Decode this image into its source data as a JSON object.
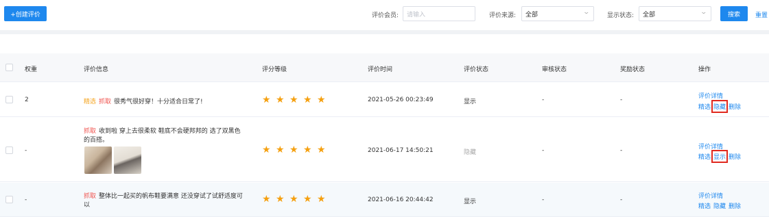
{
  "toolbar": {
    "create_label": "+创建评价",
    "member_label": "评价会员:",
    "member_placeholder": "请输入",
    "source_label": "评价来源:",
    "source_value": "全部",
    "status_label": "显示状态:",
    "status_value": "全部",
    "search_label": "搜索",
    "reset_label": "重置"
  },
  "table": {
    "headers": {
      "weight": "权重",
      "info": "评价信息",
      "rating": "评分等级",
      "time": "评价时间",
      "review_status": "评价状态",
      "audit_status": "审核状态",
      "reward_status": "奖励状态",
      "actions": "操作"
    },
    "rows": [
      {
        "weight": "2",
        "tag_featured": "精选",
        "tag_grab": "抓取",
        "text": "很秀气很好穿！十分适合日常了!",
        "rating": 5,
        "time": "2021-05-26 00:23:49",
        "review_status": "显示",
        "audit_status": "-",
        "reward_status": "-",
        "action_detail": "评价详情",
        "action_featured": "精选",
        "action_toggle": "隐藏",
        "action_delete": "删除"
      },
      {
        "weight": "-",
        "tag_grab": "抓取",
        "text": "收到啦 穿上去很柔软 鞋底不会硬邦邦的 选了双黑色",
        "text2": "的百搭。",
        "rating": 5,
        "time": "2021-06-17 14:50:21",
        "review_status": "隐藏",
        "audit_status": "-",
        "reward_status": "-",
        "action_detail": "评价详情",
        "action_featured": "精选",
        "action_toggle": "显示",
        "action_delete": "删除"
      },
      {
        "weight": "-",
        "tag_grab": "抓取",
        "text": "整体比一起买的帆布鞋要满意 还没穿试了试舒适度可",
        "text2": "以",
        "rating": 5,
        "time": "2021-06-16 20:44:42",
        "review_status": "显示",
        "audit_status": "-",
        "reward_status": "-",
        "action_detail": "评价详情",
        "action_featured": "精选",
        "action_toggle": "隐藏",
        "action_delete": "删除"
      }
    ]
  },
  "icons": {
    "star": "star-icon",
    "chevron": "chevron-down-icon"
  },
  "colors": {
    "primary": "#1e88ee",
    "star": "#f5a010",
    "featured_tag": "#f5a623",
    "grab_tag": "#f0544f",
    "highlight_box": "#e0281e"
  }
}
